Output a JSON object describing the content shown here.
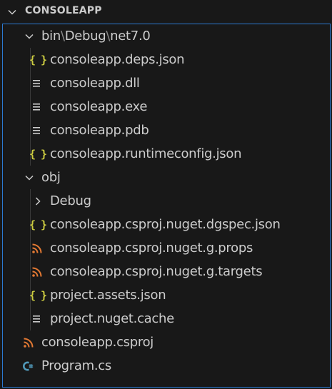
{
  "colors": {
    "background": "#181818",
    "text": "#cccccc",
    "focus_border": "#2b79d0",
    "json_icon": "#cbcb41",
    "xml_icon": "#e37933",
    "csharp_icon": "#519aba",
    "file_lines_icon": "#cccccc"
  },
  "section": {
    "title": "CONSOLEAPP",
    "icon": "chevron-down-icon"
  },
  "tree": {
    "bin": {
      "parts": [
        "bin",
        "Debug",
        "net7.0"
      ],
      "separator": "\\",
      "icon": "chevron-down-icon",
      "expanded": true,
      "children": [
        {
          "name": "consoleapp.deps.json",
          "icon": "json-icon"
        },
        {
          "name": "consoleapp.dll",
          "icon": "file-lines-icon"
        },
        {
          "name": "consoleapp.exe",
          "icon": "file-lines-icon"
        },
        {
          "name": "consoleapp.pdb",
          "icon": "file-lines-icon"
        },
        {
          "name": "consoleapp.runtimeconfig.json",
          "icon": "json-icon"
        }
      ]
    },
    "obj": {
      "name": "obj",
      "icon": "chevron-down-icon",
      "expanded": true,
      "children": [
        {
          "name": "Debug",
          "icon": "chevron-right-icon",
          "folder": true
        },
        {
          "name": "consoleapp.csproj.nuget.dgspec.json",
          "icon": "json-icon"
        },
        {
          "name": "consoleapp.csproj.nuget.g.props",
          "icon": "rss-icon"
        },
        {
          "name": "consoleapp.csproj.nuget.g.targets",
          "icon": "rss-icon"
        },
        {
          "name": "project.assets.json",
          "icon": "json-icon"
        },
        {
          "name": "project.nuget.cache",
          "icon": "file-lines-icon"
        }
      ]
    },
    "root_files": [
      {
        "name": "consoleapp.csproj",
        "icon": "rss-icon"
      },
      {
        "name": "Program.cs",
        "icon": "csharp-icon"
      }
    ]
  }
}
